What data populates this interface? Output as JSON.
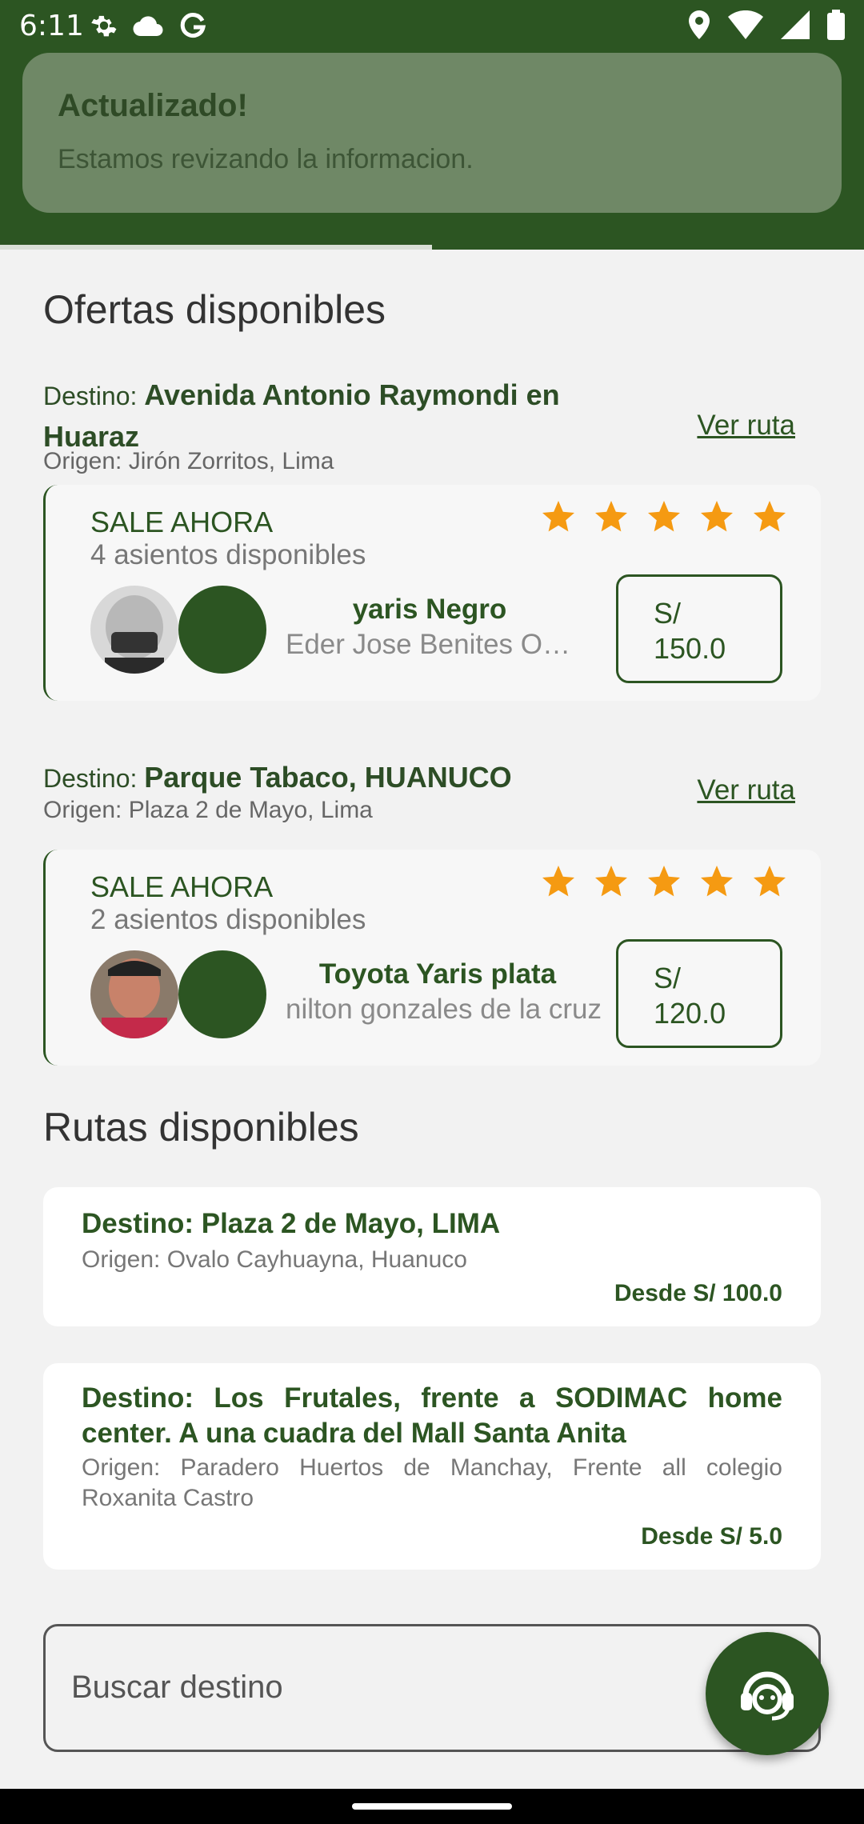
{
  "status_bar": {
    "time": "6:11",
    "icons": [
      "settings-icon",
      "cloud-icon",
      "google-icon",
      "location-icon",
      "wifi-icon",
      "signal-icon",
      "battery-icon"
    ]
  },
  "toast": {
    "title": "Actualizado!",
    "message": "Estamos revizando la informacion."
  },
  "offers_section": {
    "title": "Ofertas disponibles",
    "offers": [
      {
        "destination_prefix": "Destino: ",
        "destination": "Avenida Antonio Raymondi en Huaraz",
        "origin": "Origen: Jirón Zorritos, Lima",
        "link": "Ver ruta",
        "status": "SALE AHORA",
        "seats": "4 asientos disponibles",
        "stars": 5,
        "vehicle": "yaris Negro",
        "driver": "Eder Jose Benites Ortiz",
        "price_currency": "S/",
        "price_value": "150.0"
      },
      {
        "destination_prefix": "Destino: ",
        "destination": "Parque Tabaco, HUANUCO",
        "origin": "Origen: Plaza 2 de Mayo, Lima",
        "link": "Ver ruta",
        "status": "SALE AHORA",
        "seats": "2 asientos disponibles",
        "stars": 5,
        "vehicle": "Toyota Yaris  plata",
        "driver": "nilton gonzales de la cruz",
        "price_currency": "S/",
        "price_value": "120.0"
      }
    ]
  },
  "routes_section": {
    "title": "Rutas disponibles",
    "routes": [
      {
        "destination": "Destino: Plaza 2 de Mayo, LIMA",
        "origin": "Origen: Ovalo Cayhuayna, Huanuco",
        "price": "Desde S/ 100.0"
      },
      {
        "destination": "Destino: Los Frutales, frente a SODIMAC home center. A una cuadra del Mall Santa Anita",
        "origin": "Origen: Paradero Huertos de Manchay, Frente all colegio Roxanita Castro",
        "price": "Desde S/ 5.0"
      }
    ]
  },
  "search": {
    "placeholder": "Buscar destino"
  },
  "fab": {
    "icon": "support-agent-icon"
  },
  "colors": {
    "primary": "#2c5522",
    "star": "#f59a12",
    "toast": "#6f8866"
  }
}
